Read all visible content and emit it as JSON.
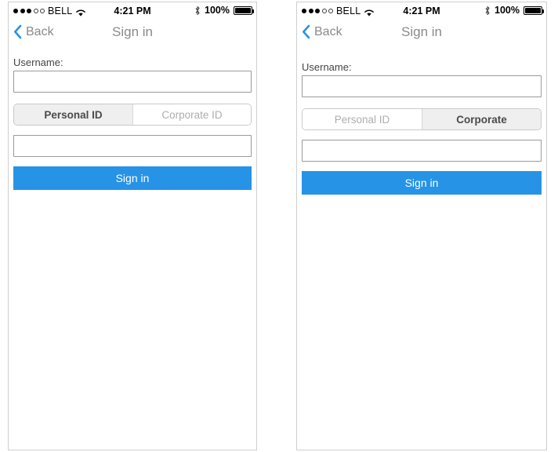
{
  "theme": {
    "accent_blue": "#2693e6",
    "nav_text_gray": "#8a8a8a",
    "segment_selected_bg": "#efefef",
    "border_gray": "#cfcfcf"
  },
  "status_bar": {
    "carrier": "BELL",
    "signal_filled_dots": 3,
    "signal_empty_dots": 2,
    "wifi_icon": "wifi-icon",
    "time": "4:21 PM",
    "bluetooth_icon": "bluetooth-icon",
    "battery_percent": "100%",
    "battery_level": 100
  },
  "nav_bar": {
    "back_icon": "chevron-left-icon",
    "back_label": "Back",
    "title": "Sign in"
  },
  "screens": [
    {
      "id": "personal",
      "username": {
        "label": "Username:",
        "value": "",
        "placeholder": ""
      },
      "segmented_control": {
        "options": [
          "Personal ID",
          "Corporate ID"
        ],
        "selected_index": 0,
        "selected_value": "Personal ID"
      },
      "secondary_input": {
        "value": "",
        "placeholder": ""
      },
      "submit_label": "Sign in"
    },
    {
      "id": "corporate",
      "username": {
        "label": "Username:",
        "value": "",
        "placeholder": ""
      },
      "segmented_control": {
        "options": [
          "Personal ID",
          "Corporate"
        ],
        "selected_index": 1,
        "selected_value": "Corporate"
      },
      "secondary_input": {
        "value": "",
        "placeholder": ""
      },
      "submit_label": "Sign in"
    }
  ]
}
